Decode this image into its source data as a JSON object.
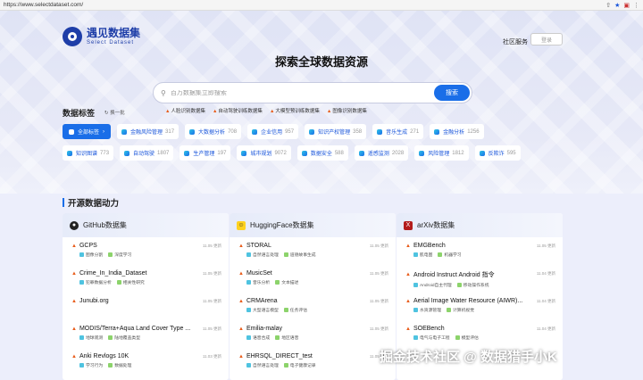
{
  "browser": {
    "url": "https://www.selectdataset.com/"
  },
  "header": {
    "logo_title": "遇见数据集",
    "logo_sub": "Select Dataset",
    "community": "社区服务",
    "login": "登录"
  },
  "hero": {
    "title": "探索全球数据资源",
    "search_placeholder": "百万数据集立即搜索",
    "search_button": "搜索",
    "hot_links": [
      "人脸识别数据集",
      "自动驾驶训练数据集",
      "大模型预训练数据集",
      "图像识别数据集"
    ]
  },
  "tags_section": {
    "title": "数据标签",
    "swap": "换一批",
    "row1": [
      {
        "label": "全部标签",
        "count": "",
        "active": true
      },
      {
        "label": "金融风险管理",
        "count": "317"
      },
      {
        "label": "大数据分析",
        "count": "708"
      },
      {
        "label": "企业信用",
        "count": "957"
      },
      {
        "label": "知识产权管理",
        "count": "358"
      },
      {
        "label": "音乐生成",
        "count": "271"
      },
      {
        "label": "金融分析",
        "count": "1256"
      }
    ],
    "row2": [
      {
        "label": "知识图谱",
        "count": "773"
      },
      {
        "label": "自动驾驶",
        "count": "1807"
      },
      {
        "label": "生产管理",
        "count": "197"
      },
      {
        "label": "城市规划",
        "count": "9072"
      },
      {
        "label": "数据安全",
        "count": "588"
      },
      {
        "label": "遥感监测",
        "count": "2028"
      },
      {
        "label": "风险管理",
        "count": "1812"
      },
      {
        "label": "反欺诈",
        "count": "595"
      }
    ]
  },
  "opensource": {
    "title": "开源数据动力",
    "columns": [
      {
        "title": "GitHub数据集",
        "items": [
          {
            "name": "GCPS",
            "time": "11.05 更新",
            "chips": [
              "图像分割",
              "深度学习"
            ]
          },
          {
            "name": "Crime_In_India_Dataset",
            "time": "11.05 更新",
            "chips": [
              "犯罪数据分析",
              "相关性研究"
            ]
          },
          {
            "name": "Junubi.org",
            "time": "11.05 更新",
            "chips": []
          },
          {
            "name": "MODIS/Terra+Aqua Land Cover Type ...",
            "time": "11.05 更新",
            "chips": [
              "地球观测",
              "陆地覆盖类型"
            ]
          },
          {
            "name": "Anki Revlogs 10K",
            "time": "11.03 更新",
            "chips": [
              "学习行为",
              "数据处理"
            ]
          }
        ]
      },
      {
        "title": "HuggingFace数据集",
        "items": [
          {
            "name": "STORAL",
            "time": "11.05 更新",
            "chips": [
              "自然语言处理",
              "道德故事生成"
            ]
          },
          {
            "name": "MusicSet",
            "time": "11.05 更新",
            "chips": [
              "音乐分析",
              "文本描述"
            ]
          },
          {
            "name": "CRMArena",
            "time": "11.05 更新",
            "chips": [
              "大型语言模型",
              "任务评估"
            ]
          },
          {
            "name": "Emilia-malay",
            "time": "11.05 更新",
            "chips": [
              "语音合成",
              "地区语音"
            ]
          },
          {
            "name": "EHRSQL_DIRECT_test",
            "time": "11.05 更新",
            "chips": [
              "自然语言处理",
              "电子健康记录"
            ]
          }
        ]
      },
      {
        "title": "arXiv数据集",
        "items": [
          {
            "name": "EMGBench",
            "time": "11.05 更新",
            "chips": [
              "肌电图",
              "机器学习"
            ]
          },
          {
            "name": "Android Instruct Android 指令",
            "time": "11.04 更新",
            "chips": [
              "Android自主代理",
              "移动操作系统"
            ]
          },
          {
            "name": "Aerial Image Water Resource (AIWR)...",
            "time": "11.04 更新",
            "chips": [
              "水资源管理",
              "计算机视觉"
            ]
          },
          {
            "name": "SOEBench",
            "time": "11.04 更新",
            "chips": [
              "电气与电子工程",
              "模型评估"
            ]
          }
        ]
      }
    ]
  },
  "watermark": "掘金技术社区 @ 数据猎手小K"
}
